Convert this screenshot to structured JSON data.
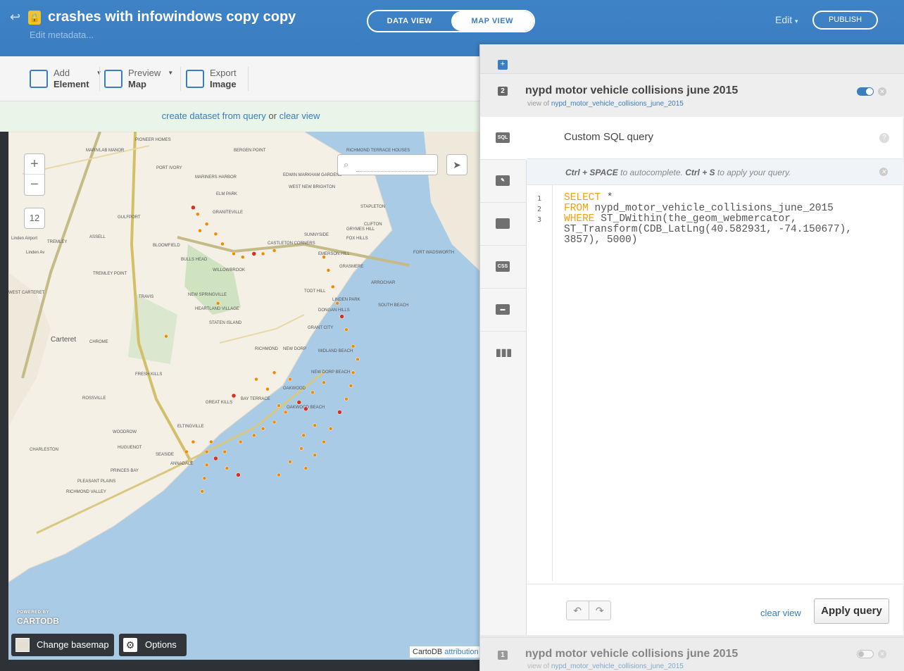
{
  "header": {
    "title": "crashes with infowindows copy copy",
    "edit_metadata": "Edit metadata...",
    "data_view_label": "DATA VIEW",
    "map_view_label": "MAP VIEW",
    "edit_label": "Edit",
    "publish_label": "PUBLISH"
  },
  "toolbar": {
    "add_element": {
      "line1": "Add",
      "line2": "Element"
    },
    "preview_map": {
      "line1": "Preview",
      "line2": "Map"
    },
    "export_image": {
      "line1": "Export",
      "line2": "Image"
    }
  },
  "notice": {
    "create_link": "create dataset from query",
    "or_text": " or ",
    "clear_link": "clear view"
  },
  "map": {
    "zoom_in": "+",
    "zoom_out": "−",
    "zoom_level": "12",
    "search_placeholder": "",
    "powered_by": "POWERED BY",
    "brand": "CARTODB",
    "change_basemap": "Change basemap",
    "options": "Options",
    "attribution_prefix": "CartoDB",
    "attribution_link": "attribution",
    "labels": [
      {
        "t": "PIONEER HOMES"
      },
      {
        "t": "MARIVLAB MANOR"
      },
      {
        "t": "PORT IVORY"
      },
      {
        "t": "BERGEN POINT"
      },
      {
        "t": "RICHMOND TERRACE HOUSES"
      },
      {
        "t": "EDWIN MARKHAM GARDENS"
      },
      {
        "t": "WEST NEW BRIGHTON"
      },
      {
        "t": "MARINERS HARBOR"
      },
      {
        "t": "ELM PARK"
      },
      {
        "t": "GULFPORT"
      },
      {
        "t": "GRANITEVILLE"
      },
      {
        "t": "STAPLETON"
      },
      {
        "t": "CLIFTON"
      },
      {
        "t": "GRYMES HILL"
      },
      {
        "t": "SUNNYSIDE"
      },
      {
        "t": "FOX HILLS"
      },
      {
        "t": "CASTLETON CORNERS"
      },
      {
        "t": "BLOOMFIELD"
      },
      {
        "t": "BULLS HEAD"
      },
      {
        "t": "WILLOWBROOK"
      },
      {
        "t": "EMERSON HILL"
      },
      {
        "t": "FORT WADSWORTH"
      },
      {
        "t": "GRASMERE"
      },
      {
        "t": "ARROCHAR"
      },
      {
        "t": "TREMLEY"
      },
      {
        "t": "TREMLEY POINT"
      },
      {
        "t": "TRAVIS"
      },
      {
        "t": "NEW SPRINGVILLE"
      },
      {
        "t": "HEARTLAND VILLAGE"
      },
      {
        "t": "TODT HILL"
      },
      {
        "t": "LINDEN PARK"
      },
      {
        "t": "SOUTH BEACH"
      },
      {
        "t": "DONGAN HILLS"
      },
      {
        "t": "GRANT CITY"
      },
      {
        "t": "STATEN ISLAND"
      },
      {
        "t": "WEST CARTERET"
      },
      {
        "t": "Carteret"
      },
      {
        "t": "CHROME"
      },
      {
        "t": "RICHMOND"
      },
      {
        "t": "NEW DORP"
      },
      {
        "t": "MIDLAND BEACH"
      },
      {
        "t": "NEW DORP BEACH"
      },
      {
        "t": "FRESH KILLS"
      },
      {
        "t": "GREAT KILLS"
      },
      {
        "t": "BAY TERRACE"
      },
      {
        "t": "OAKWOOD"
      },
      {
        "t": "OAKWOOD BEACH"
      },
      {
        "t": "ROSSVILLE"
      },
      {
        "t": "ELTINGVILLE"
      },
      {
        "t": "WOODROW"
      },
      {
        "t": "HUGUENOT"
      },
      {
        "t": "CHARLESTON"
      },
      {
        "t": "SEASIDE"
      },
      {
        "t": "ANNADALE"
      },
      {
        "t": "PRINCES BAY"
      },
      {
        "t": "PLEASANT PLAINS"
      },
      {
        "t": "RICHMOND VALLEY"
      },
      {
        "t": "ASSELL"
      },
      {
        "t": "Linden Airport"
      },
      {
        "t": "Linden Av"
      }
    ],
    "points": [
      [
        40.627,
        -74.178
      ],
      [
        40.625,
        -74.176
      ],
      [
        40.622,
        -74.172
      ],
      [
        40.619,
        -74.168
      ],
      [
        40.616,
        -74.165
      ],
      [
        40.613,
        -74.16
      ],
      [
        40.612,
        -74.156
      ],
      [
        40.613,
        -74.151
      ],
      [
        40.613,
        -74.147
      ],
      [
        40.614,
        -74.142
      ],
      [
        40.612,
        -74.12
      ],
      [
        40.608,
        -74.118
      ],
      [
        40.603,
        -74.116
      ],
      [
        40.598,
        -74.114
      ],
      [
        40.594,
        -74.112
      ],
      [
        40.59,
        -74.11
      ],
      [
        40.585,
        -74.107
      ],
      [
        40.581,
        -74.105
      ],
      [
        40.577,
        -74.107
      ],
      [
        40.573,
        -74.108
      ],
      [
        40.569,
        -74.11
      ],
      [
        40.565,
        -74.113
      ],
      [
        40.56,
        -74.117
      ],
      [
        40.556,
        -74.12
      ],
      [
        40.552,
        -74.124
      ],
      [
        40.548,
        -74.128
      ],
      [
        40.574,
        -74.12
      ],
      [
        40.571,
        -74.125
      ],
      [
        40.568,
        -74.131
      ],
      [
        40.565,
        -74.137
      ],
      [
        40.562,
        -74.142
      ],
      [
        40.56,
        -74.147
      ],
      [
        40.558,
        -74.151
      ],
      [
        40.556,
        -74.157
      ],
      [
        40.553,
        -74.164
      ],
      [
        40.551,
        -74.168
      ],
      [
        40.556,
        -74.17
      ],
      [
        40.553,
        -74.172
      ],
      [
        40.549,
        -74.172
      ],
      [
        40.545,
        -74.173
      ],
      [
        40.541,
        -74.174
      ],
      [
        40.548,
        -74.163
      ],
      [
        40.546,
        -74.158
      ],
      [
        40.556,
        -74.178
      ],
      [
        40.553,
        -74.181
      ],
      [
        40.575,
        -74.15
      ],
      [
        40.572,
        -74.145
      ],
      [
        40.577,
        -74.142
      ],
      [
        40.575,
        -74.135
      ],
      [
        40.566,
        -74.128
      ],
      [
        40.561,
        -74.124
      ],
      [
        40.558,
        -74.129
      ],
      [
        40.554,
        -74.13
      ],
      [
        40.55,
        -74.135
      ],
      [
        40.546,
        -74.14
      ],
      [
        40.567,
        -74.14
      ],
      [
        40.57,
        -74.16
      ],
      [
        40.588,
        -74.19
      ],
      [
        40.598,
        -74.167
      ],
      [
        40.62,
        -74.175
      ]
    ]
  },
  "panel": {
    "add_layer": "+",
    "layer2": {
      "num": "2",
      "name": "nypd motor vehicle collisions june 2015",
      "view_of": "view of",
      "table": "nypd_motor_vehicle_collisions_june_2015"
    },
    "layer1": {
      "num": "1",
      "name": "nypd motor vehicle collisions june 2015",
      "view_of": "view of",
      "table": "nypd_motor_vehicle_collisions_june_2015"
    },
    "side_icons": {
      "sql": "SQL",
      "css": "CSS"
    },
    "sql_title": "Custom SQL query",
    "help": "?",
    "hint_k1": "Ctrl + SPACE",
    "hint_t1": " to autocomplete. ",
    "hint_k2": "Ctrl + S",
    "hint_t2": " to apply your query.",
    "line_numbers": [
      "1",
      "2",
      "3"
    ],
    "code": {
      "l1_kw": "SELECT",
      "l1_rest": " *",
      "l2_kw": "FROM",
      "l2_rest": " nypd_motor_vehicle_collisions_june_2015",
      "l3_kw": "WHERE",
      "l3_rest": " ST_DWithin(the_geom_webmercator,",
      "l4": "ST_Transform(CDB_LatLng(40.582931, -74.150677),",
      "l5": "3857), 5000)"
    },
    "clear_view": "clear view",
    "apply_query": "Apply query"
  },
  "colors": {
    "accent": "#3a7dc0",
    "keyword": "#f5a00f",
    "point": "#f18a00",
    "point_dark": "#d7301f"
  }
}
